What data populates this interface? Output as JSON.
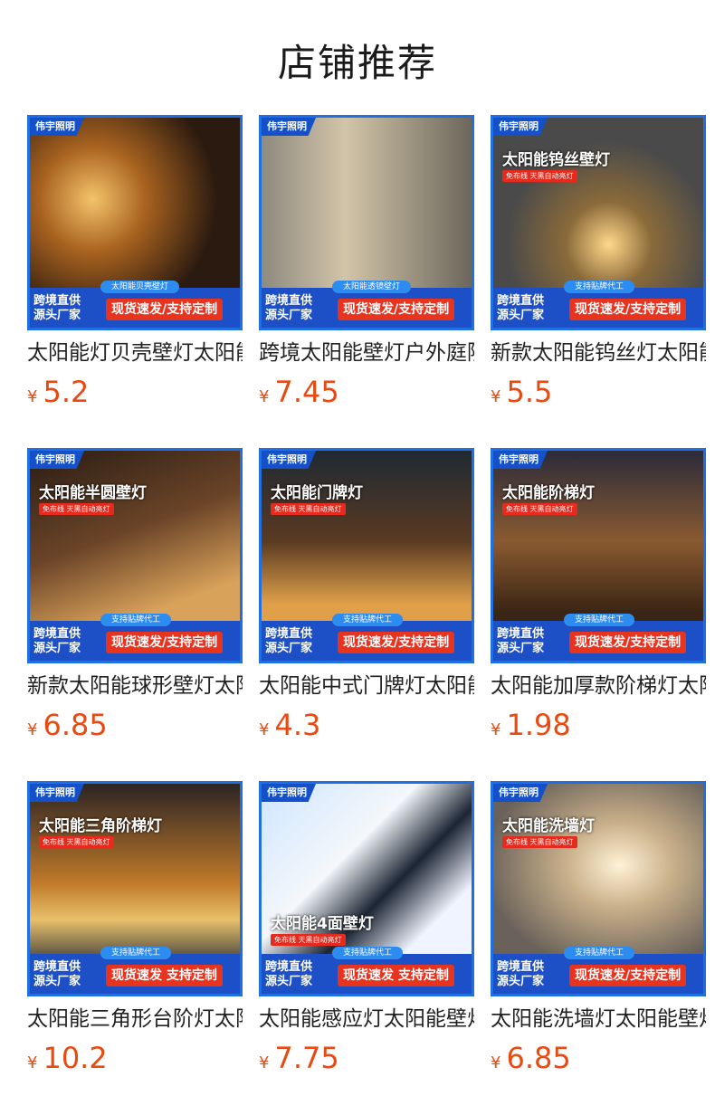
{
  "header": {
    "title": "店铺推荐"
  },
  "common": {
    "brand": "伟宇照明",
    "origin_line1": "跨境直供",
    "origin_line2": "源头厂家",
    "currency": "¥"
  },
  "products": [
    {
      "name": "太阳能灯贝壳壁灯太阳能户外",
      "price": "5.2",
      "overlay_title": "",
      "overlay_sub": "",
      "ribbon": "太阳能贝壳壁灯",
      "badge": "现货速发/支持定制"
    },
    {
      "name": "跨境太阳能壁灯户外庭院",
      "price": "7.45",
      "overlay_title": "",
      "overlay_sub": "",
      "ribbon": "太阳能透镜壁灯",
      "badge": "现货速发/支持定制"
    },
    {
      "name": "新款太阳能钨丝灯太阳能",
      "price": "5.5",
      "overlay_title": "太阳能钨丝壁灯",
      "overlay_sub": "免布线 天黑自动亮灯",
      "ribbon": "支持贴牌代工",
      "badge": "现货速发/支持定制"
    },
    {
      "name": "新款太阳能球形壁灯太阳能",
      "price": "6.85",
      "overlay_title": "太阳能半圆壁灯",
      "overlay_sub": "免布线 天黑自动亮灯",
      "ribbon": "支持贴牌代工",
      "badge": "现货速发/支持定制"
    },
    {
      "name": "太阳能中式门牌灯太阳能",
      "price": "4.3",
      "overlay_title": "太阳能门牌灯",
      "overlay_sub": "免布线 天黑自动亮灯",
      "ribbon": "支持贴牌代工",
      "badge": "现货速发/支持定制"
    },
    {
      "name": "太阳能加厚款阶梯灯太阳能",
      "price": "1.98",
      "overlay_title": "太阳能阶梯灯",
      "overlay_sub": "免布线 天黑自动亮灯",
      "ribbon": "支持贴牌代工",
      "badge": "现货速发/支持定制"
    },
    {
      "name": "太阳能三角形台阶灯太阳能",
      "price": "10.2",
      "overlay_title": "太阳能三角阶梯灯",
      "overlay_sub": "免布线 天黑自动亮灯",
      "ribbon": "支持贴牌代工",
      "badge": "现货速发 支持定制"
    },
    {
      "name": "太阳能感应灯太阳能壁灯",
      "price": "7.75",
      "overlay_title": "太阳能4面壁灯",
      "overlay_sub": "免布线 天黑自动亮灯",
      "ribbon": "支持贴牌代工",
      "badge": "现货速发 支持定制"
    },
    {
      "name": "太阳能洗墙灯太阳能壁灯",
      "price": "6.85",
      "overlay_title": "太阳能洗墙灯",
      "overlay_sub": "免布线 天黑自动亮灯",
      "ribbon": "支持贴牌代工",
      "badge": "现货速发/支持定制"
    }
  ]
}
